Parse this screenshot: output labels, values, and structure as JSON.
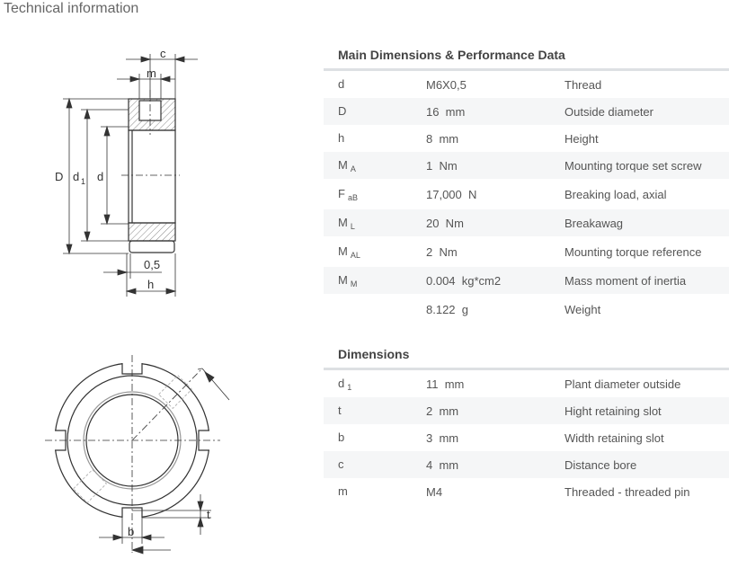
{
  "page_title": "Technical information",
  "drawing_labels": {
    "side": {
      "c": "c",
      "m": "m",
      "D": "D",
      "d1": "d",
      "d1_sub": "1",
      "d": "d",
      "offset": "0,5",
      "h": "h"
    },
    "front": {
      "b": "b",
      "t": "t"
    }
  },
  "main_section": {
    "title": "Main Dimensions & Performance Data",
    "rows": [
      {
        "symbol": "d",
        "sub": "",
        "value": "M6X0,5",
        "description": "Thread"
      },
      {
        "symbol": "D",
        "sub": "",
        "value": "16  mm",
        "description": "Outside diameter"
      },
      {
        "symbol": "h",
        "sub": "",
        "value": "8  mm",
        "description": "Height"
      },
      {
        "symbol": "M",
        "sub": "A",
        "value": "1  Nm",
        "description": "Mounting torque set screw"
      },
      {
        "symbol": "F",
        "sub": "aB",
        "value": "17,000  N",
        "description": "Breaking load, axial"
      },
      {
        "symbol": "M",
        "sub": "L",
        "value": "20  Nm",
        "description": "Breakawag"
      },
      {
        "symbol": "M",
        "sub": "AL",
        "value": "2  Nm",
        "description": "Mounting torque reference"
      },
      {
        "symbol": "M",
        "sub": "M",
        "value": "0.004  kg*cm2",
        "description": "Mass moment of inertia"
      },
      {
        "symbol": "",
        "sub": "",
        "value": "8.122  g",
        "description": "Weight"
      }
    ]
  },
  "dimensions_section": {
    "title": "Dimensions",
    "rows": [
      {
        "symbol": "d",
        "sub": "1",
        "value": "11  mm",
        "description": "Plant diameter outside"
      },
      {
        "symbol": "t",
        "sub": "",
        "value": "2  mm",
        "description": "Hight retaining slot"
      },
      {
        "symbol": "b",
        "sub": "",
        "value": "3  mm",
        "description": "Width retaining slot"
      },
      {
        "symbol": "c",
        "sub": "",
        "value": "4  mm",
        "description": "Distance bore"
      },
      {
        "symbol": "m",
        "sub": "",
        "value": "M4",
        "description": "Threaded - threaded pin"
      }
    ]
  }
}
